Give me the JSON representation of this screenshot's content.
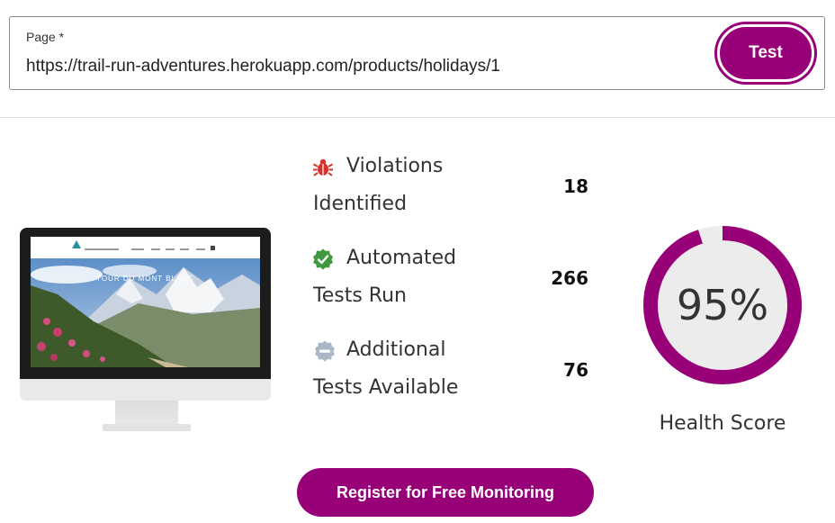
{
  "url_field": {
    "label": "Page *",
    "value": "https://trail-run-adventures.herokuapp.com/products/holidays/1"
  },
  "test_button": {
    "label": "Test"
  },
  "preview": {
    "hero_title": "TOUR DU MONT BLANC"
  },
  "stats": [
    {
      "icon": "bug-icon",
      "line1": "Violations",
      "line2": "Identified",
      "value": "18",
      "color": "#d9322c"
    },
    {
      "icon": "check-badge-icon",
      "line1": "Automated",
      "line2": "Tests Run",
      "value": "266",
      "color": "#3f9a3f"
    },
    {
      "icon": "minus-badge-icon",
      "line1": "Additional",
      "line2": "Tests Available",
      "value": "76",
      "color": "#a9b8c4"
    }
  ],
  "health": {
    "score_text": "95%",
    "score_fraction": 0.95,
    "caption": "Health Score",
    "ring_color": "#980078",
    "track_color": "#ececec"
  },
  "register_button": {
    "label": "Register for Free Monitoring"
  },
  "colors": {
    "accent": "#980078"
  }
}
